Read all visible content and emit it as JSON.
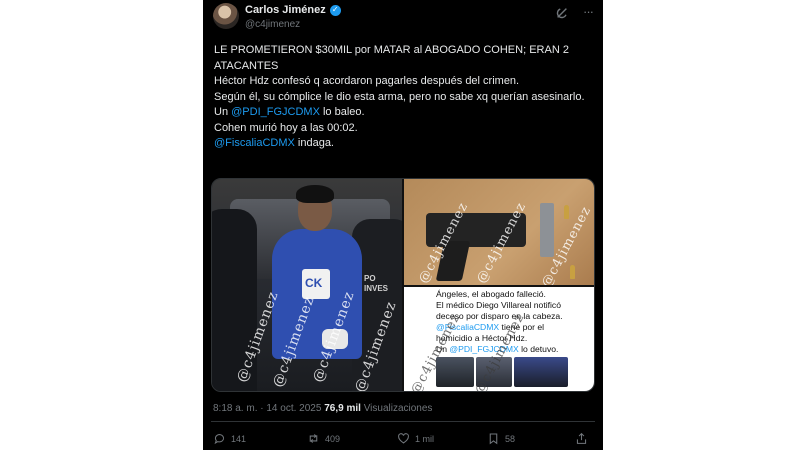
{
  "author": {
    "display_name": "Carlos Jiménez",
    "handle": "@c4jimenez",
    "verified_mark": "✓"
  },
  "header_icons": {
    "grok": "grok-icon",
    "more": "more-icon",
    "more_glyph": "···"
  },
  "tweet": {
    "line1": "LE PROMETIERON $30MIL por MATAR al ABOGADO COHEN; ERAN 2 ATACANTES",
    "line2": "Héctor Hdz confesó q acordaron pagarles después del crimen.",
    "line3": "Según él, su cómplice le dio esta arma, pero no sabe xq querían asesinarlo.",
    "line4_prefix": "Un ",
    "line4_mention": "@PDI_FGJCDMX",
    "line4_suffix": " lo baleo.",
    "line5": "Cohen murió hoy a las 00:02.",
    "line6_mention": "@FiscaliaCDMX",
    "line6_suffix": " indaga."
  },
  "media": {
    "watermark": "@c4jimenez",
    "police_text_1": "PO",
    "police_text_2": "INVES",
    "screenshot_text": {
      "l1": "Ángeles, el abogado falleció.",
      "l2": "El médico Diego Villareal notificó",
      "l3": "deceso por disparo en la cabeza.",
      "l4_mention": "@FiscaliaCDMX",
      "l4_suffix": " tiene por el",
      "l5": "homicidio a Héctor Hdz.",
      "l6_prefix": "Un ",
      "l6_mention": "@PDI_FGJCDMX",
      "l6_suffix": " lo detuvo."
    }
  },
  "meta": {
    "time": "8:18 a. m.",
    "separator": "·",
    "date": "14 oct. 2025",
    "views_count": "76,9 mil",
    "views_label": "Visualizaciones"
  },
  "actions": {
    "replies": "141",
    "reposts": "409",
    "likes": "1 mil",
    "bookmarks": "58"
  },
  "colors": {
    "background": "#000000",
    "text": "#e7e9ea",
    "muted": "#71767b",
    "accent": "#1d9bf0",
    "divider": "#2f3336"
  }
}
